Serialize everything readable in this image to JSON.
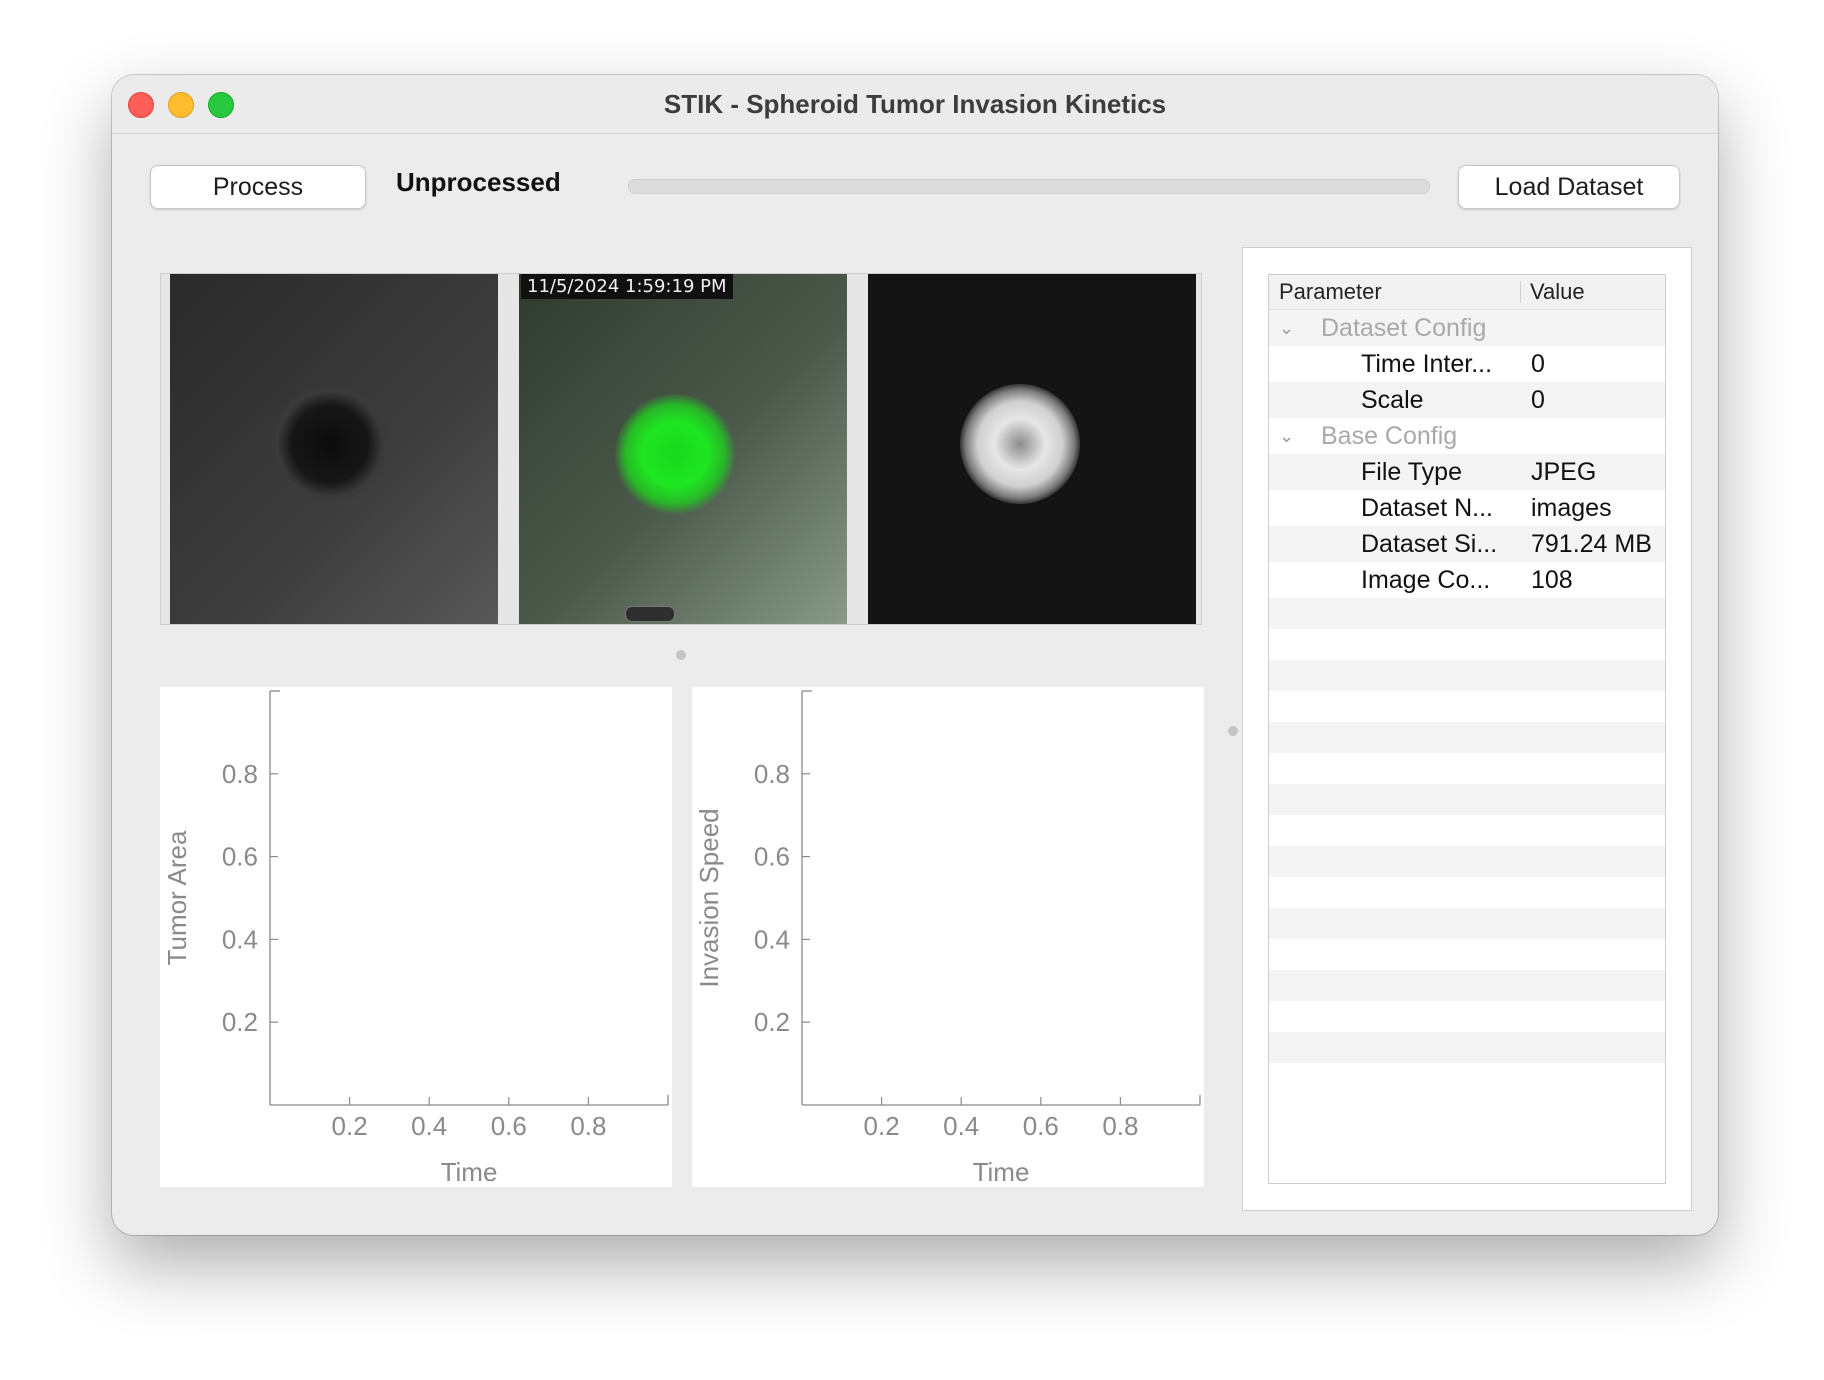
{
  "window": {
    "title": "STIK - Spheroid Tumor Invasion Kinetics"
  },
  "toolbar": {
    "process_label": "Process",
    "status": "Unprocessed",
    "progress": 0,
    "load_label": "Load Dataset"
  },
  "images": {
    "timestamp": "11/5/2024 1:59:19 PM"
  },
  "charts": {
    "area": {
      "ylabel": "Tumor Area",
      "xlabel": "Time",
      "ticks": [
        "0.2",
        "0.4",
        "0.6",
        "0.8"
      ]
    },
    "speed": {
      "ylabel": "Invasion Speed",
      "xlabel": "Time",
      "ticks": [
        "0.2",
        "0.4",
        "0.6",
        "0.8"
      ]
    }
  },
  "chart_data": [
    {
      "type": "line",
      "xlabel": "Time",
      "ylabel": "Tumor Area",
      "xlim": [
        0,
        1
      ],
      "ylim": [
        0,
        1
      ],
      "xticks": [
        0.2,
        0.4,
        0.6,
        0.8
      ],
      "yticks": [
        0.2,
        0.4,
        0.6,
        0.8
      ],
      "series": []
    },
    {
      "type": "line",
      "xlabel": "Time",
      "ylabel": "Invasion Speed",
      "xlim": [
        0,
        1
      ],
      "ylim": [
        0,
        1
      ],
      "xticks": [
        0.2,
        0.4,
        0.6,
        0.8
      ],
      "yticks": [
        0.2,
        0.4,
        0.6,
        0.8
      ],
      "series": []
    }
  ],
  "params": {
    "header": {
      "parameter": "Parameter",
      "value": "Value"
    },
    "groups": [
      {
        "label": "Dataset Config",
        "rows": [
          {
            "name": "Time Inter...",
            "value": "0"
          },
          {
            "name": "Scale",
            "value": "0"
          }
        ]
      },
      {
        "label": "Base Config",
        "rows": [
          {
            "name": "File Type",
            "value": "JPEG"
          },
          {
            "name": "Dataset N...",
            "value": "images"
          },
          {
            "name": "Dataset Si...",
            "value": "791.24 MB"
          },
          {
            "name": "Image Co...",
            "value": "108"
          }
        ]
      }
    ]
  },
  "icons": {
    "group_toggle": "chevron-down-icon"
  }
}
